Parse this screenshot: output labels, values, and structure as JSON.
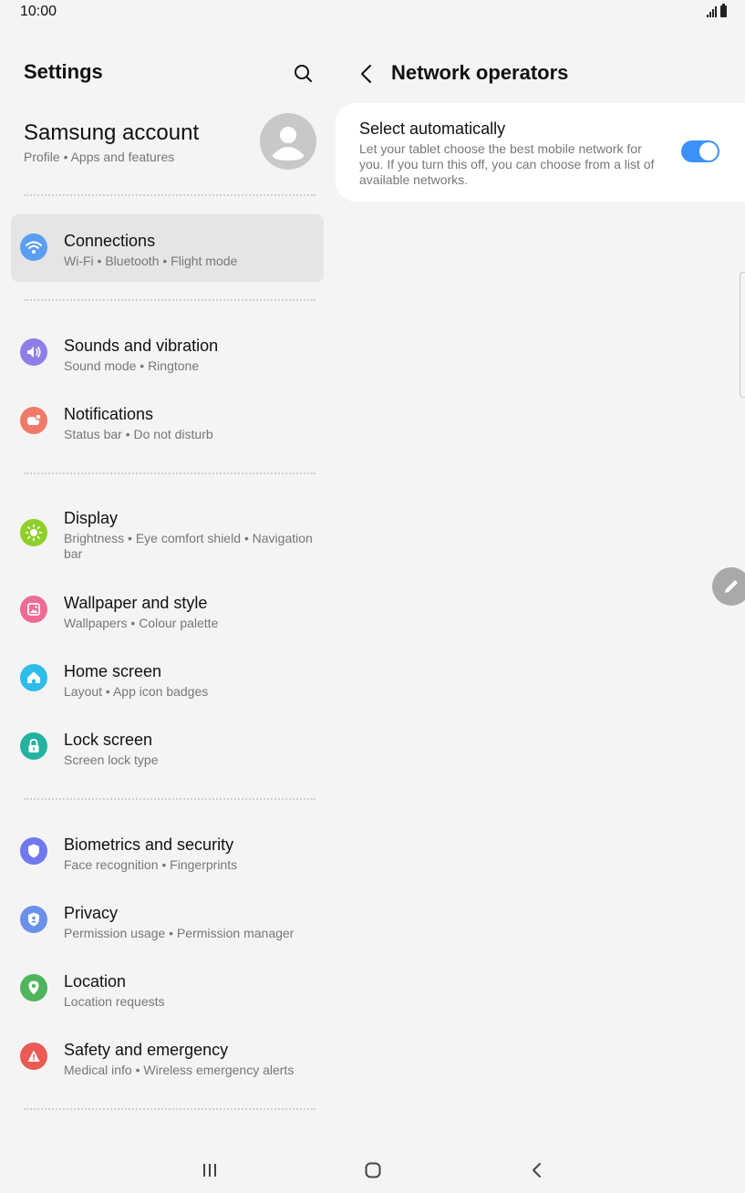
{
  "status_bar": {
    "time": "10:00"
  },
  "left": {
    "title": "Settings",
    "account": {
      "title": "Samsung account",
      "subtitle": "Profile  •  Apps and features"
    },
    "items": [
      {
        "label": "Connections",
        "sub": "Wi-Fi  •  Bluetooth  •  Flight mode",
        "icon": "wifi-icon",
        "color": "#5a9ef2",
        "selected": true
      },
      {
        "label": "Sounds and vibration",
        "sub": "Sound mode  •  Ringtone",
        "icon": "speaker-icon",
        "color": "#8f7ee8"
      },
      {
        "label": "Notifications",
        "sub": "Status bar  •  Do not disturb",
        "icon": "notification-icon",
        "color": "#f07a6a"
      },
      {
        "label": "Display",
        "sub": "Brightness  •  Eye comfort shield  •  Navigation bar",
        "icon": "sun-icon",
        "color": "#8fcf2a"
      },
      {
        "label": "Wallpaper and style",
        "sub": "Wallpapers  •  Colour palette",
        "icon": "image-icon",
        "color": "#ee6b94"
      },
      {
        "label": "Home screen",
        "sub": "Layout  •  App icon badges",
        "icon": "home-icon",
        "color": "#2ebde8"
      },
      {
        "label": "Lock screen",
        "sub": "Screen lock type",
        "icon": "lock-icon",
        "color": "#24b3a0"
      },
      {
        "label": "Biometrics and security",
        "sub": "Face recognition  •  Fingerprints",
        "icon": "shield-icon",
        "color": "#6f78ee"
      },
      {
        "label": "Privacy",
        "sub": "Permission usage  •  Permission manager",
        "icon": "privacy-shield-icon",
        "color": "#6a90ea"
      },
      {
        "label": "Location",
        "sub": "Location requests",
        "icon": "location-pin-icon",
        "color": "#4fb45c"
      },
      {
        "label": "Safety and emergency",
        "sub": "Medical info  •  Wireless emergency alerts",
        "icon": "alert-icon",
        "color": "#ea5b54"
      }
    ]
  },
  "right": {
    "title": "Network operators",
    "option": {
      "title": "Select automatically",
      "description": "Let your tablet choose the best mobile network for you. If you turn this off, you can choose from a list of available networks.",
      "enabled": true,
      "toggle_color": "#3e91f7"
    }
  }
}
